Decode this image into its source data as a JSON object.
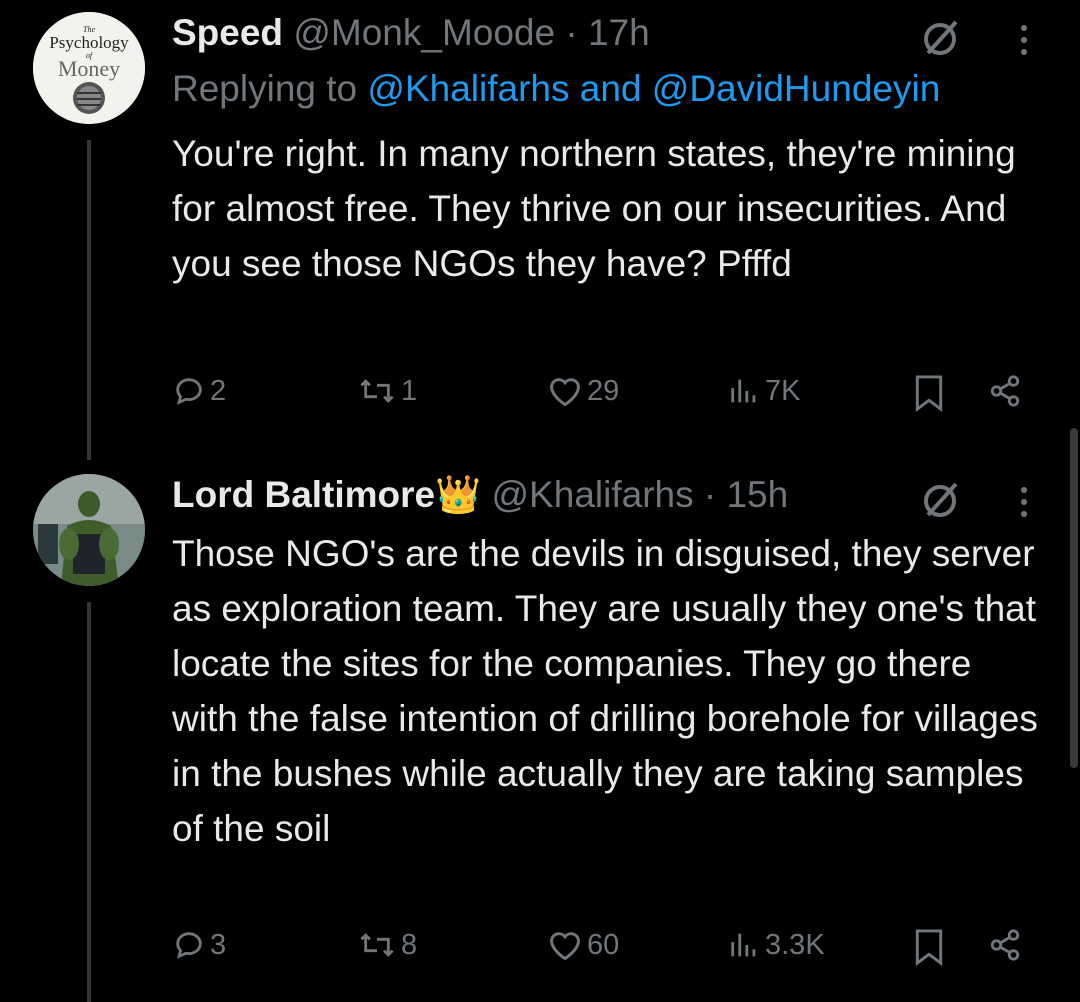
{
  "tweets": [
    {
      "name": "Speed",
      "handle": "@Monk_Moode",
      "time": "· 17h",
      "replying_prefix": "Replying to",
      "reply_user1": "@Khalifarhs",
      "reply_and": "and",
      "reply_user2": "@DavidHundeyin",
      "text": "You're right. In many northern states, they're mining for almost free. They thrive on our insecurities. And you see those NGOs they have? Pfffd",
      "replies": "2",
      "reposts": "1",
      "likes": "29",
      "views": "7K",
      "avatar_text": {
        "the": "The",
        "line1": "Psychology",
        "of": "of",
        "line2": "Money"
      }
    },
    {
      "name": "Lord Baltimore👑",
      "handle": "@Khalifarhs",
      "time": "· 15h",
      "text": "Those NGO's are the devils in disguised, they server as exploration team. They are usually they one's that locate the sites for the companies. They go there with the false intention of drilling borehole for villages in the bushes while actually they are taking samples of the soil",
      "replies": "3",
      "reposts": "8",
      "likes": "60",
      "views": "3.3K"
    }
  ],
  "colors": {
    "background": "#000000",
    "text": "#e7e9ea",
    "muted": "#71767b",
    "link": "#1d9bf0"
  }
}
